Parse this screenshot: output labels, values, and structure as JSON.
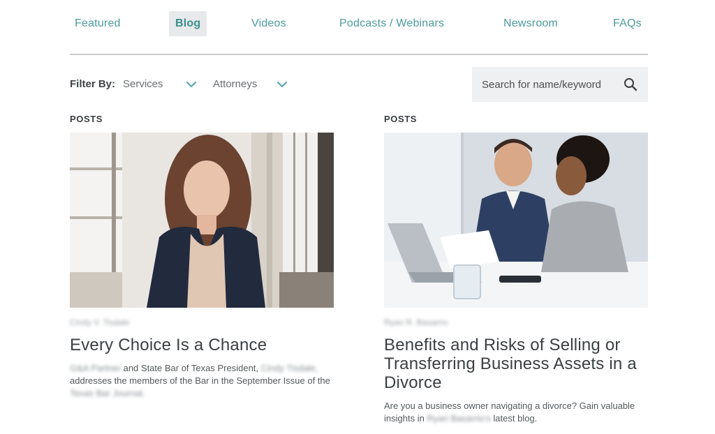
{
  "nav": {
    "items": [
      {
        "label": "Featured",
        "active": false
      },
      {
        "label": "Blog",
        "active": true
      },
      {
        "label": "Videos",
        "active": false
      },
      {
        "label": "Podcasts / Webinars",
        "active": false
      },
      {
        "label": "Newsroom",
        "active": false
      },
      {
        "label": "FAQs",
        "active": false
      }
    ]
  },
  "filter": {
    "label": "Filter By:",
    "services": "Services",
    "attorneys": "Attorneys",
    "chevron_icon": "chevron-down-icon"
  },
  "search": {
    "placeholder": "Search for name/keyword",
    "icon": "search-icon"
  },
  "posts": [
    {
      "kicker": "POSTS",
      "author": "Cindy V. Tisdale",
      "title": "Every Choice Is a Chance",
      "excerpt": {
        "part1": "G&A Partner",
        "part2": " and State Bar of Texas President, ",
        "part3": "Cindy Tisdale,",
        "part4": " addresses the members of the Bar in the September Issue of the ",
        "part5": "Texas Bar Journal."
      }
    },
    {
      "kicker": "POSTS",
      "author": "Ryan R. Basarrio",
      "title": "Benefits and Risks of Selling or Transferring Business Assets in a Divorce",
      "excerpt": {
        "part1": "Are you a business owner navigating a divorce? Gain valuable insights in ",
        "part2": "Ryan Basarrio's",
        "part3": " latest blog."
      }
    }
  ],
  "colors": {
    "accent": "#4a9b9a",
    "rule": "#c9ccce",
    "search_bg": "#eef0f1"
  }
}
